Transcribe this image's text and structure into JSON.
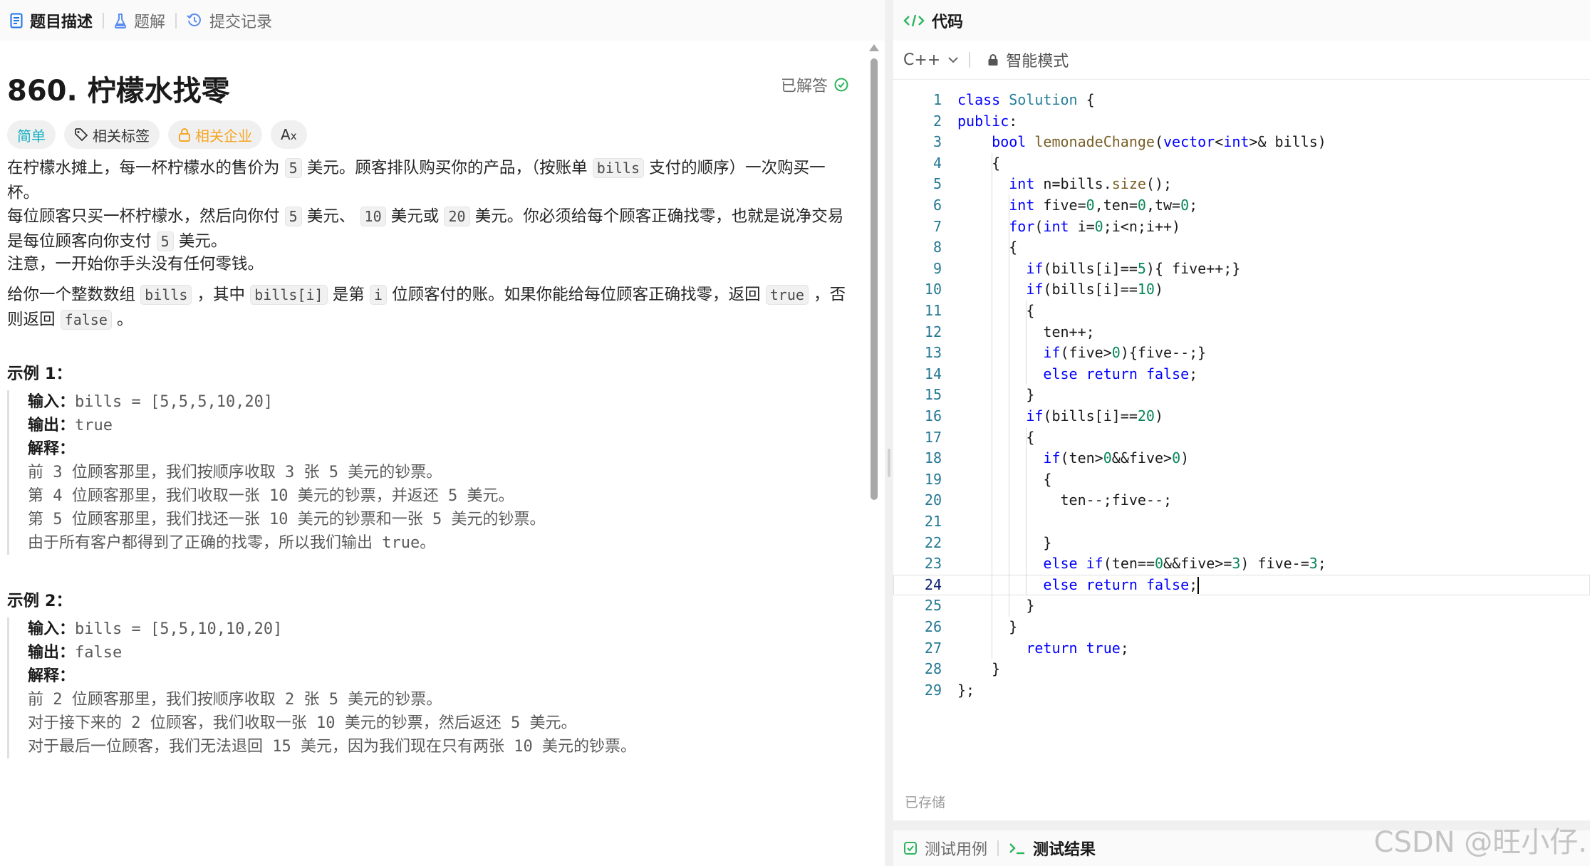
{
  "left_tabs": [
    {
      "label": "题目描述",
      "icon": "document-icon"
    },
    {
      "label": "题解",
      "icon": "flask-icon"
    },
    {
      "label": "提交记录",
      "icon": "history-icon"
    }
  ],
  "problem": {
    "title": "860. 柠檬水找零",
    "status": "已解答",
    "tags": {
      "difficulty": "简单",
      "related_tags": "相关标签",
      "companies": "相关企业"
    },
    "p1": {
      "a": "在柠檬水摊上，每一杯柠檬水的售价为",
      "c1": "5",
      "b": "美元。顾客排队购买你的产品，（按账单",
      "c2": "bills",
      "d": "支付的顺序）一次购买一杯。"
    },
    "p2": {
      "a": "每位顾客只买一杯柠檬水，然后向你付",
      "c1": "5",
      "b": "美元、",
      "c2": "10",
      "c": "美元或",
      "c3": "20",
      "d": "美元。你必须给每个顾客正确找零，也就是说净交易是每位顾客向你支付",
      "c4": "5",
      "e": "美元。"
    },
    "p3": "注意，一开始你手头没有任何零钱。",
    "p4": {
      "a": "给你一个整数数组",
      "c1": "bills",
      "b": "，其中",
      "c2": "bills[i]",
      "c": "是第",
      "c3": "i",
      "d": "位顾客付的账。如果你能给每位顾客正确找零，返回",
      "c4": "true",
      "e": "，否则返回",
      "c5": "false",
      "f": "。"
    }
  },
  "examples": [
    {
      "header": "示例 1：",
      "input_label": "输入：",
      "input": "bills = [5,5,5,10,20]",
      "output_label": "输出：",
      "output": "true",
      "explain_label": "解释：",
      "lines": [
        "前 3 位顾客那里，我们按顺序收取 3 张 5 美元的钞票。",
        "第 4 位顾客那里，我们收取一张 10 美元的钞票，并返还 5 美元。",
        "第 5 位顾客那里，我们找还一张 10 美元的钞票和一张 5 美元的钞票。",
        "由于所有客户都得到了正确的找零，所以我们输出 true。"
      ]
    },
    {
      "header": "示例 2：",
      "input_label": "输入：",
      "input": "bills = [5,5,10,10,20]",
      "output_label": "输出：",
      "output": "false",
      "explain_label": "解释：",
      "lines": [
        "前 2 位顾客那里，我们按顺序收取 2 张 5 美元的钞票。",
        "对于接下来的 2 位顾客，我们收取一张 10 美元的钞票，然后返还 5 美元。",
        "对于最后一位顾客，我们无法退回 15 美元，因为我们现在只有两张 10 美元的钞票。"
      ]
    }
  ],
  "right": {
    "tab": "代码",
    "language": "C++",
    "mode": "智能模式",
    "saved": "已存储",
    "bottom_tabs": [
      "测试用例",
      "测试结果"
    ],
    "current_line": 24
  },
  "code_lines": [
    "class Solution {",
    "public:",
    "    bool lemonadeChange(vector<int>& bills)",
    "    {",
    "      int n=bills.size();",
    "      int five=0,ten=0,tw=0;",
    "      for(int i=0;i<n;i++)",
    "      {",
    "        if(bills[i]==5){ five++;}",
    "        if(bills[i]==10)",
    "        {",
    "          ten++;",
    "          if(five>0){five--;}",
    "          else return false;",
    "        }",
    "        if(bills[i]==20)",
    "        {",
    "          if(ten>0&&five>0)",
    "          {",
    "            ten--;five--;",
    "",
    "          }",
    "          else if(ten==0&&five>=3) five-=3;",
    "          else return false;",
    "        }",
    "      }",
    "        return true;",
    "    }",
    "};"
  ],
  "watermark": "CSDN @旺小仔."
}
